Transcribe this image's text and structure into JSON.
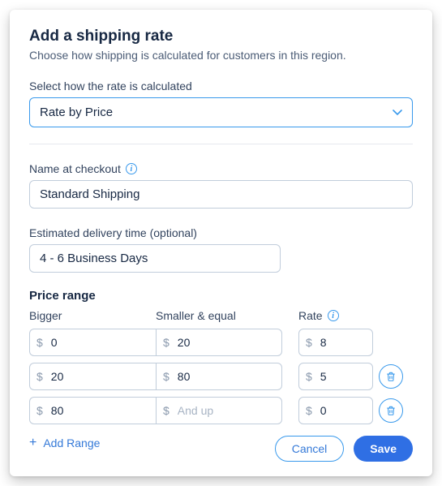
{
  "header": {
    "title": "Add a shipping rate",
    "subtitle": "Choose how shipping is calculated for customers in this region."
  },
  "rate_calc": {
    "label": "Select how the rate is calculated",
    "value": "Rate by Price"
  },
  "name": {
    "label": "Name at checkout",
    "value": "Standard Shipping"
  },
  "delivery": {
    "label": "Estimated delivery time (optional)",
    "value": "4 - 6 Business Days"
  },
  "price_range": {
    "title": "Price range",
    "cols": {
      "bigger": "Bigger",
      "smaller": "Smaller & equal",
      "rate": "Rate"
    },
    "currency": "$",
    "and_up_placeholder": "And up",
    "rows": [
      {
        "bigger": "0",
        "smaller": "20",
        "rate": "8",
        "deletable": false
      },
      {
        "bigger": "20",
        "smaller": "80",
        "rate": "5",
        "deletable": true
      },
      {
        "bigger": "80",
        "smaller": "",
        "rate": "0",
        "deletable": true
      }
    ],
    "add_label": "Add Range"
  },
  "footer": {
    "cancel": "Cancel",
    "save": "Save"
  },
  "info_glyph": "i"
}
